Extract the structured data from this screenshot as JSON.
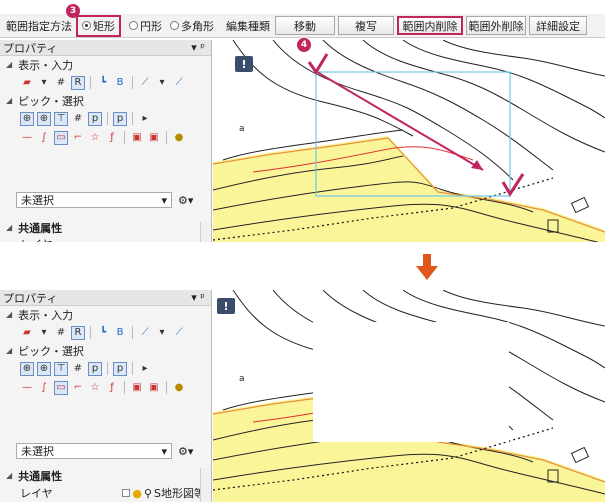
{
  "toolbar": {
    "range_method_label": "範囲指定方法",
    "radio_rect": "矩形",
    "radio_circle": "円形",
    "radio_polygon": "多角形",
    "edit_type_label": "編集種類",
    "move": "移動",
    "copy": "複写",
    "delete_inside": "範囲内削除",
    "delete_outside": "範囲外削除",
    "detail_settings": "詳細設定"
  },
  "badges": {
    "step3": "3",
    "step4": "4"
  },
  "panel": {
    "title": "プロパティ",
    "section_display": "表示・入力",
    "section_pick": "ピック・選択",
    "select_value": "未選択",
    "common_attr": "共通属性",
    "layer_label": "レイヤ",
    "layer_value": "S地形図等"
  },
  "canvas": {
    "warning": "!",
    "point_label": "a"
  },
  "colors": {
    "accent": "#c0255f",
    "fill": "#fbf59a",
    "arrow": "#e0571c",
    "selection": "#6fc7e6"
  }
}
